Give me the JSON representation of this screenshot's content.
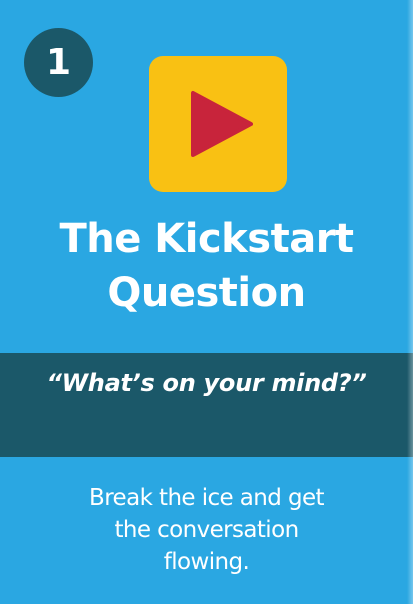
{
  "card": {
    "number": "1",
    "icon": "play-icon",
    "title_line1": "The Kickstart",
    "title_line2": "Question",
    "quote": "“What’s on your mind?”",
    "description_line1": "Break the ice and get",
    "description_line2": "the conversation",
    "description_line3": "flowing."
  },
  "colors": {
    "background": "#2aa7e2",
    "badge_and_band": "#1b5869",
    "tile": "#f9c113",
    "play_triangle": "#c8243b",
    "text": "#ffffff"
  }
}
